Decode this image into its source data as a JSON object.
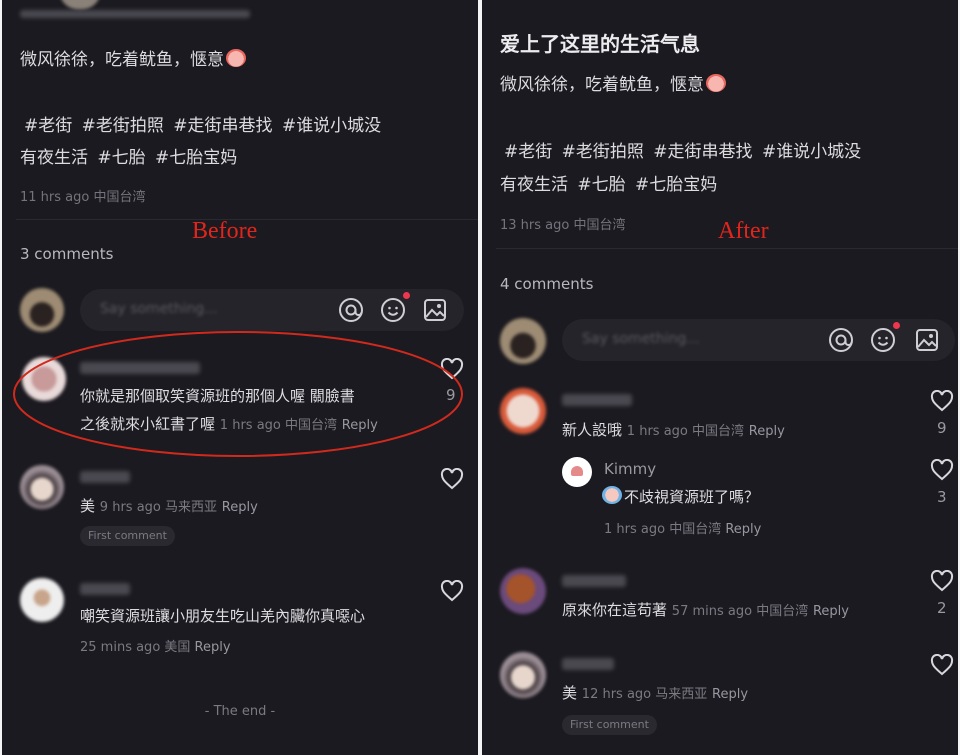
{
  "before": {
    "label": "Before",
    "post": {
      "description": "微风徐徐，吃着鱿鱼，惬意",
      "hashtags_line1": "#老街  #老街拍照  #走街串巷找  #谁说小城没",
      "hashtags_line2": "有夜生活  #七胎  #七胎宝妈",
      "meta": "11 hrs ago 中国台湾"
    },
    "comments_count": "3 comments",
    "input_placeholder": "Say something...",
    "comments": [
      {
        "text_line1": "你就是那個取笑資源班的那個人喔 關臉書",
        "text_line2": "之後就來小紅書了喔",
        "meta": "1 hrs ago 中国台湾",
        "reply": "Reply",
        "likes": "9",
        "highlighted": true
      },
      {
        "text": "美",
        "meta": "9 hrs ago 马来西亚",
        "reply": "Reply",
        "badge": "First comment"
      },
      {
        "text": "嘲笑資源班讓小朋友生吃山羌內臟你真噁心",
        "meta": "25 mins ago 美国",
        "reply": "Reply"
      }
    ],
    "end_text": "- The end -"
  },
  "after": {
    "label": "After",
    "post": {
      "title": "爱上了这里的生活气息",
      "description": "微风徐徐，吃着鱿鱼，惬意",
      "hashtags_line1": "#老街  #老街拍照  #走街串巷找  #谁说小城没",
      "hashtags_line2": "有夜生活  #七胎  #七胎宝妈",
      "meta": "13 hrs ago 中国台湾"
    },
    "comments_count": "4 comments",
    "input_placeholder": "Say something...",
    "comments": [
      {
        "text": "新人設哦",
        "meta": "1 hrs ago 中国台湾",
        "reply": "Reply",
        "likes": "9",
        "sub_reply": {
          "username": "Kimmy",
          "text": "不歧視資源班了嗎？",
          "meta": "1 hrs ago 中国台湾",
          "reply": "Reply",
          "likes": "3"
        }
      },
      {
        "text": "原來你在這苟著",
        "meta": "57 mins ago 中国台湾",
        "reply": "Reply",
        "likes": "2"
      },
      {
        "text": "美",
        "meta": "12 hrs ago 马来西亚",
        "reply": "Reply",
        "badge": "First comment"
      }
    ]
  },
  "colors": {
    "background": "#1b1a20",
    "annotation_red": "#e0261c",
    "notification_dot": "#f0354f"
  },
  "icons": [
    "at-icon",
    "emoji-icon",
    "image-icon",
    "heart-icon"
  ]
}
